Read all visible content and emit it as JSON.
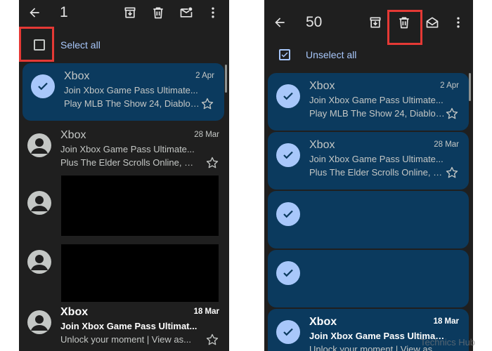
{
  "left_panel": {
    "selected_count": "1",
    "select_all_label": "Select all",
    "emails": [
      {
        "sender": "Xbox",
        "date": "2 Apr",
        "subject": "Join Xbox Game Pass Ultimate...",
        "snippet": "Play MLB The Show 24, Diablo I...",
        "selected": true,
        "unread": false
      },
      {
        "sender": "Xbox",
        "date": "28 Mar",
        "subject": "Join Xbox Game Pass Ultimate...",
        "snippet": "Plus The Elder Scrolls Online, D...",
        "selected": false,
        "unread": false
      },
      {
        "sender": "",
        "date": "",
        "subject": "",
        "snippet": "",
        "selected": false,
        "redacted": true
      },
      {
        "sender": "",
        "date": "",
        "subject": "",
        "snippet": "",
        "selected": false,
        "redacted": true
      },
      {
        "sender": "Xbox",
        "date": "18 Mar",
        "subject": "Join Xbox Game Pass Ultimat...",
        "snippet": "Unlock your moment | View as...",
        "selected": false,
        "unread": true
      }
    ]
  },
  "right_panel": {
    "selected_count": "50",
    "select_all_label": "Unselect all",
    "emails": [
      {
        "sender": "Xbox",
        "date": "2 Apr",
        "subject": "Join Xbox Game Pass Ultimate...",
        "snippet": "Play MLB The Show 24, Diablo I...",
        "selected": true,
        "unread": false
      },
      {
        "sender": "Xbox",
        "date": "28 Mar",
        "subject": "Join Xbox Game Pass Ultimate...",
        "snippet": "Plus The Elder Scrolls Online, D...",
        "selected": true,
        "unread": false
      },
      {
        "sender": "",
        "date": "",
        "subject": "",
        "snippet": "",
        "selected": true,
        "redacted": true
      },
      {
        "sender": "",
        "date": "",
        "subject": "",
        "snippet": "",
        "selected": true,
        "redacted": true
      },
      {
        "sender": "Xbox",
        "date": "18 Mar",
        "subject": "Join Xbox Game Pass Ultimat...",
        "snippet": "Unlock your moment | View as...",
        "selected": true,
        "unread": true
      }
    ]
  },
  "icons": {
    "back": "arrow-back-icon",
    "archive": "archive-icon",
    "delete": "trash-icon",
    "mark_unread": "mark-unread-icon",
    "mark_read": "mark-read-icon",
    "more": "more-vert-icon"
  },
  "colors": {
    "background": "#1f1f1f",
    "selected_row": "#0b3a5e",
    "accent": "#a8c7fa",
    "highlight": "#e53935"
  },
  "watermark": "Technics Hub"
}
